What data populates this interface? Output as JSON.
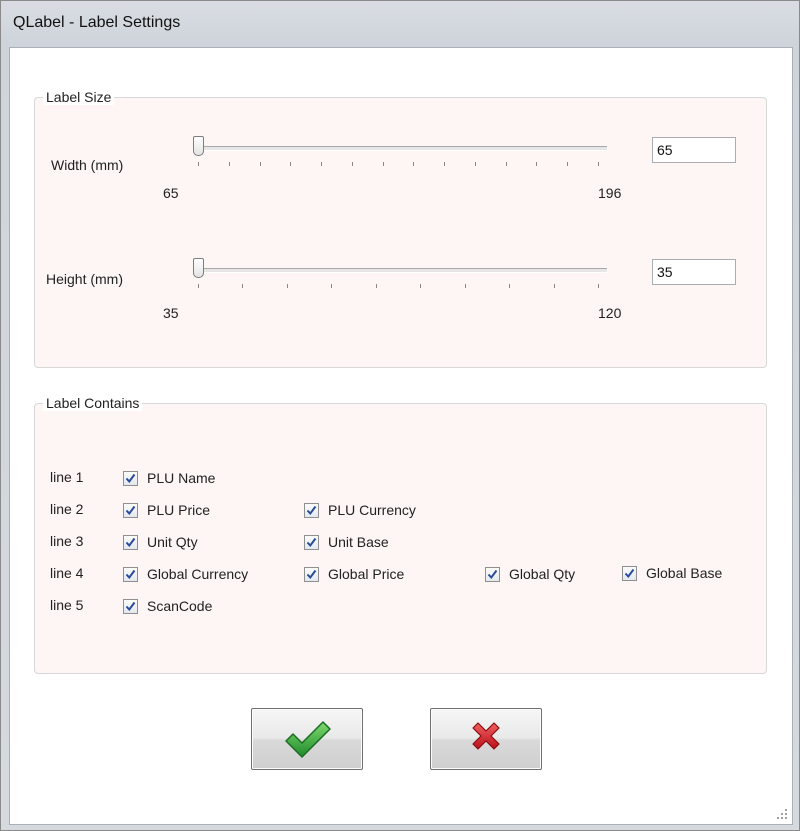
{
  "window": {
    "title": "QLabel - Label Settings"
  },
  "label_size": {
    "title": "Label Size",
    "width": {
      "label": "Width (mm)",
      "min": "65",
      "max": "196",
      "value": "65",
      "level": 0
    },
    "height": {
      "label": "Height (mm)",
      "min": "35",
      "max": "120",
      "value": "35",
      "level": 0
    }
  },
  "label_contains": {
    "title": "Label Contains",
    "lines": [
      {
        "label": "line 1",
        "items": [
          {
            "label": "PLU Name",
            "checked": true
          }
        ]
      },
      {
        "label": "line 2",
        "items": [
          {
            "label": "PLU Price",
            "checked": true
          },
          {
            "label": "PLU Currency",
            "checked": true
          }
        ]
      },
      {
        "label": "line 3",
        "items": [
          {
            "label": "Unit Qty",
            "checked": true
          },
          {
            "label": "Unit Base",
            "checked": true
          }
        ]
      },
      {
        "label": "line 4",
        "items": [
          {
            "label": "Global Currency",
            "checked": true
          },
          {
            "label": "Global Price",
            "checked": true
          },
          {
            "label": "Global Qty",
            "checked": true
          },
          {
            "label": "Global Base",
            "checked": true
          }
        ]
      },
      {
        "label": "line 5",
        "items": [
          {
            "label": "ScanCode",
            "checked": true
          }
        ]
      }
    ]
  },
  "buttons": {
    "ok_icon": "green-checkmark-icon",
    "cancel_icon": "red-x-icon",
    "ok_color": "#2fa536",
    "cancel_color": "#d8242c"
  },
  "colors": {
    "group_background": "#fdf6f5",
    "checkmark": "#2a4a9a"
  }
}
